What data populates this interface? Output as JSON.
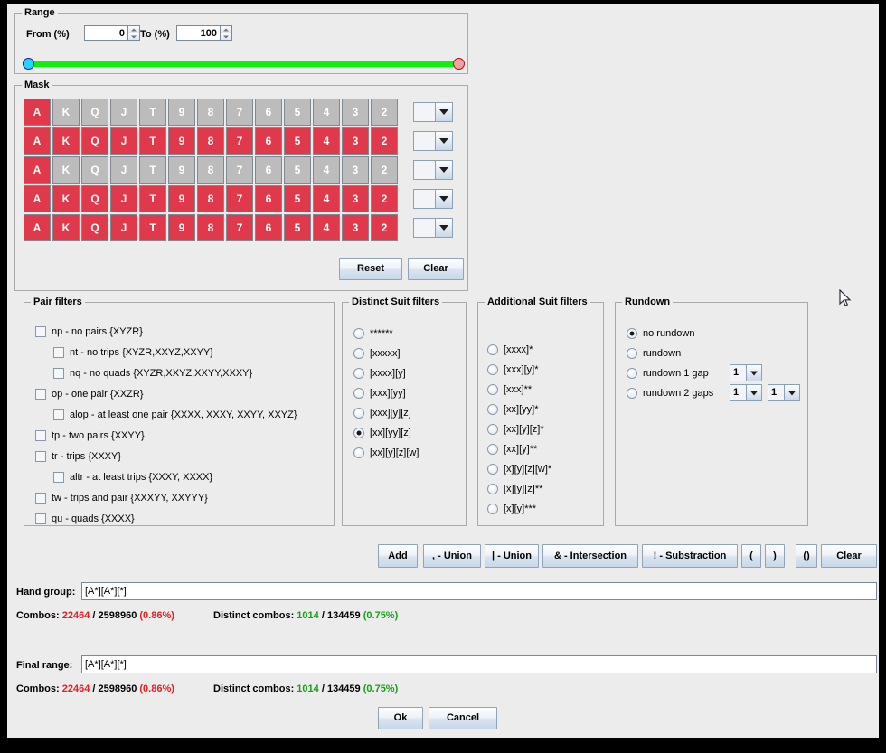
{
  "range": {
    "title": "Range",
    "from_label": "From (%)",
    "from_value": "0",
    "to_label": "To (%)",
    "to_value": "100",
    "slider_from_pct": 0,
    "slider_to_pct": 100,
    "track_color": "#10f010",
    "from_knob_color": "#22d5ff",
    "to_knob_color": "#f4a0a0"
  },
  "mask": {
    "title": "Mask",
    "on_color": "#e0394b",
    "off_color": "#bcbcbc",
    "ranks": [
      "A",
      "K",
      "Q",
      "J",
      "T",
      "9",
      "8",
      "7",
      "6",
      "5",
      "4",
      "3",
      "2"
    ],
    "rows": [
      {
        "selected": [
          true,
          false,
          false,
          false,
          false,
          false,
          false,
          false,
          false,
          false,
          false,
          false,
          false
        ],
        "combo_value": ""
      },
      {
        "selected": [
          true,
          true,
          true,
          true,
          true,
          true,
          true,
          true,
          true,
          true,
          true,
          true,
          true
        ],
        "combo_value": ""
      },
      {
        "selected": [
          true,
          false,
          false,
          false,
          false,
          false,
          false,
          false,
          false,
          false,
          false,
          false,
          false
        ],
        "combo_value": ""
      },
      {
        "selected": [
          true,
          true,
          true,
          true,
          true,
          true,
          true,
          true,
          true,
          true,
          true,
          true,
          true
        ],
        "combo_value": ""
      },
      {
        "selected": [
          true,
          true,
          true,
          true,
          true,
          true,
          true,
          true,
          true,
          true,
          true,
          true,
          true
        ],
        "combo_value": ""
      }
    ],
    "reset_label": "Reset",
    "clear_label": "Clear"
  },
  "pair_filters": {
    "title": "Pair filters",
    "items": [
      {
        "label": "np - no pairs {XYZR}",
        "checked": false,
        "indent": 0
      },
      {
        "label": "nt - no trips {XYZR,XXYZ,XXYY}",
        "checked": false,
        "indent": 1
      },
      {
        "label": "nq - no quads {XYZR,XXYZ,XXYY,XXXY}",
        "checked": false,
        "indent": 1
      },
      {
        "label": "op - one pair {XXZR}",
        "checked": false,
        "indent": 0
      },
      {
        "label": "alop - at least one pair {XXXX, XXXY, XXYY, XXYZ}",
        "checked": false,
        "indent": 1
      },
      {
        "label": "tp - two pairs {XXYY}",
        "checked": false,
        "indent": 0
      },
      {
        "label": "tr - trips {XXXY}",
        "checked": false,
        "indent": 0
      },
      {
        "label": "altr - at least trips {XXXY, XXXX}",
        "checked": false,
        "indent": 1
      },
      {
        "label": "tw - trips and pair {XXXYY, XXYYY}",
        "checked": false,
        "indent": 0
      },
      {
        "label": "qu - quads {XXXX}",
        "checked": false,
        "indent": 0
      }
    ]
  },
  "distinct_suit_filters": {
    "title": "Distinct Suit filters",
    "items": [
      {
        "label": "******",
        "selected": false
      },
      {
        "label": "[xxxxx]",
        "selected": false
      },
      {
        "label": "[xxxx][y]",
        "selected": false
      },
      {
        "label": "[xxx][yy]",
        "selected": false
      },
      {
        "label": "[xxx][y][z]",
        "selected": false
      },
      {
        "label": "[xx][yy][z]",
        "selected": true
      },
      {
        "label": "[xx][y][z][w]",
        "selected": false
      }
    ]
  },
  "additional_suit_filters": {
    "title": "Additional Suit filters",
    "items": [
      {
        "label": "[xxxx]*",
        "selected": false
      },
      {
        "label": "[xxx][y]*",
        "selected": false
      },
      {
        "label": "[xxx]**",
        "selected": false
      },
      {
        "label": "[xx][yy]*",
        "selected": false
      },
      {
        "label": "[xx][y][z]*",
        "selected": false
      },
      {
        "label": "[xx][y]**",
        "selected": false
      },
      {
        "label": "[x][y][z][w]*",
        "selected": false
      },
      {
        "label": "[x][y][z]**",
        "selected": false
      },
      {
        "label": "[x][y]***",
        "selected": false
      }
    ]
  },
  "rundown": {
    "title": "Rundown",
    "items": [
      {
        "label": "no rundown",
        "selected": true,
        "combos": []
      },
      {
        "label": "rundown",
        "selected": false,
        "combos": []
      },
      {
        "label": "rundown 1 gap",
        "selected": false,
        "combos": [
          "1"
        ]
      },
      {
        "label": "rundown 2 gaps",
        "selected": false,
        "combos": [
          "1",
          "1"
        ]
      }
    ]
  },
  "operators": {
    "add_label": "Add",
    "comma_union_label": ", - Union",
    "pipe_union_label": "| - Union",
    "intersection_label": "& - Intersection",
    "substraction_label": "! - Substraction",
    "paren_open_label": "(",
    "paren_close_label": ")",
    "paren_pair_label": "()",
    "clear_label": "Clear"
  },
  "hand_group": {
    "label": "Hand group:",
    "value": "[A*][A*][*]",
    "combos_label": "Combos:",
    "combos_value": "22464",
    "combos_total": "/ 2598960",
    "combos_pct": "(0.86%)",
    "distinct_label": "Distinct combos:",
    "distinct_value": "1014",
    "distinct_total": "/ 134459",
    "distinct_pct": "(0.75%)"
  },
  "final_range": {
    "label": "Final range:",
    "value": "[A*][A*][*]",
    "combos_label": "Combos:",
    "combos_value": "22464",
    "combos_total": "/ 2598960",
    "combos_pct": "(0.86%)",
    "distinct_label": "Distinct combos:",
    "distinct_value": "1014",
    "distinct_total": "/ 134459",
    "distinct_pct": "(0.75%)"
  },
  "dialog_buttons": {
    "ok_label": "Ok",
    "cancel_label": "Cancel"
  },
  "colors": {
    "background": "#ececec",
    "selected_red": "#e0394b",
    "unselected_gray": "#bcbcbc",
    "stat_red": "#e02020",
    "stat_green": "#16a016"
  }
}
